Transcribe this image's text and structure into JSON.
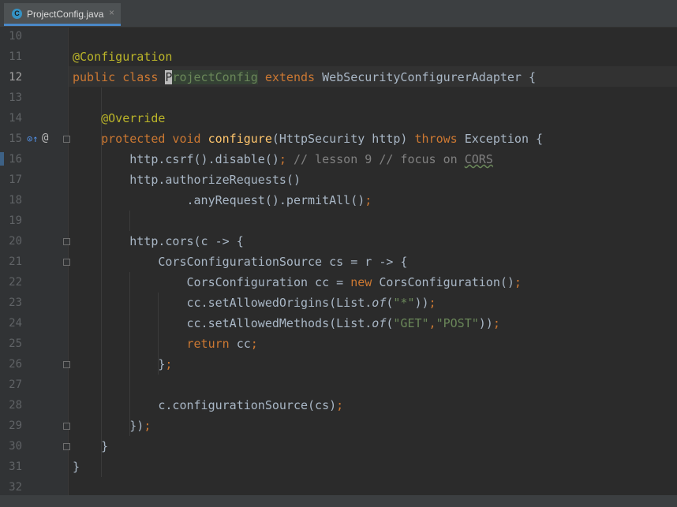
{
  "tab": {
    "icon": "class-c-icon",
    "label": "ProjectConfig.java",
    "close": "×"
  },
  "gutter_icons": {
    "override": "⊙↑",
    "at": "@"
  },
  "lines": [
    {
      "n": "10",
      "seg": []
    },
    {
      "n": "11",
      "seg": [
        [
          "ann",
          "@Configuration"
        ]
      ]
    },
    {
      "n": "12",
      "seg": [
        [
          "kw",
          "public class "
        ],
        [
          "cursor",
          "P"
        ],
        [
          "hl",
          "rojectConfig"
        ],
        [
          "p",
          " "
        ],
        [
          "kw",
          "extends "
        ],
        [
          "p",
          "WebSecurityConfigurerAdapter {"
        ]
      ]
    },
    {
      "n": "13",
      "seg": []
    },
    {
      "n": "14",
      "seg": [
        [
          "p",
          "    "
        ],
        [
          "ann",
          "@Override"
        ]
      ]
    },
    {
      "n": "15",
      "seg": [
        [
          "p",
          "    "
        ],
        [
          "kw",
          "protected void "
        ],
        [
          "fn",
          "configure"
        ],
        [
          "p",
          "(HttpSecurity http) "
        ],
        [
          "kw",
          "throws "
        ],
        [
          "p",
          "Exception {"
        ]
      ]
    },
    {
      "n": "16",
      "seg": [
        [
          "p",
          "        http.csrf().disable()"
        ],
        [
          "kw",
          ";"
        ],
        [
          "cmt",
          " // lesson 9 // focus on "
        ],
        [
          "typo",
          "CORS"
        ]
      ]
    },
    {
      "n": "17",
      "seg": [
        [
          "p",
          "        http.authorizeRequests()"
        ]
      ]
    },
    {
      "n": "18",
      "seg": [
        [
          "p",
          "                .anyRequest().permitAll()"
        ],
        [
          "kw",
          ";"
        ]
      ]
    },
    {
      "n": "19",
      "seg": []
    },
    {
      "n": "20",
      "seg": [
        [
          "p",
          "        http.cors(c -> {"
        ]
      ]
    },
    {
      "n": "21",
      "seg": [
        [
          "p",
          "            CorsConfigurationSource cs = r -> {"
        ]
      ]
    },
    {
      "n": "22",
      "seg": [
        [
          "p",
          "                CorsConfiguration cc = "
        ],
        [
          "kw",
          "new "
        ],
        [
          "p",
          "CorsConfiguration()"
        ],
        [
          "kw",
          ";"
        ]
      ]
    },
    {
      "n": "23",
      "seg": [
        [
          "p",
          "                cc.setAllowedOrigins(List."
        ],
        [
          "it",
          "of"
        ],
        [
          "p",
          "("
        ],
        [
          "str",
          "\"*\""
        ],
        [
          "p",
          "))"
        ],
        [
          "kw",
          ";"
        ]
      ]
    },
    {
      "n": "24",
      "seg": [
        [
          "p",
          "                cc.setAllowedMethods(List."
        ],
        [
          "it",
          "of"
        ],
        [
          "p",
          "("
        ],
        [
          "str",
          "\"GET\""
        ],
        [
          "kw",
          ","
        ],
        [
          "str",
          "\"POST\""
        ],
        [
          "p",
          "))"
        ],
        [
          "kw",
          ";"
        ]
      ]
    },
    {
      "n": "25",
      "seg": [
        [
          "p",
          "                "
        ],
        [
          "kw",
          "return "
        ],
        [
          "p",
          "cc"
        ],
        [
          "kw",
          ";"
        ]
      ]
    },
    {
      "n": "26",
      "seg": [
        [
          "p",
          "            }"
        ],
        [
          "kw",
          ";"
        ]
      ]
    },
    {
      "n": "27",
      "seg": []
    },
    {
      "n": "28",
      "seg": [
        [
          "p",
          "            c.configurationSource(cs)"
        ],
        [
          "kw",
          ";"
        ]
      ]
    },
    {
      "n": "29",
      "seg": [
        [
          "p",
          "        })"
        ],
        [
          "kw",
          ";"
        ]
      ]
    },
    {
      "n": "30",
      "seg": [
        [
          "p",
          "    }"
        ]
      ]
    },
    {
      "n": "31",
      "seg": [
        [
          "p",
          "}"
        ]
      ]
    },
    {
      "n": "32",
      "seg": []
    }
  ],
  "current_line": "12"
}
